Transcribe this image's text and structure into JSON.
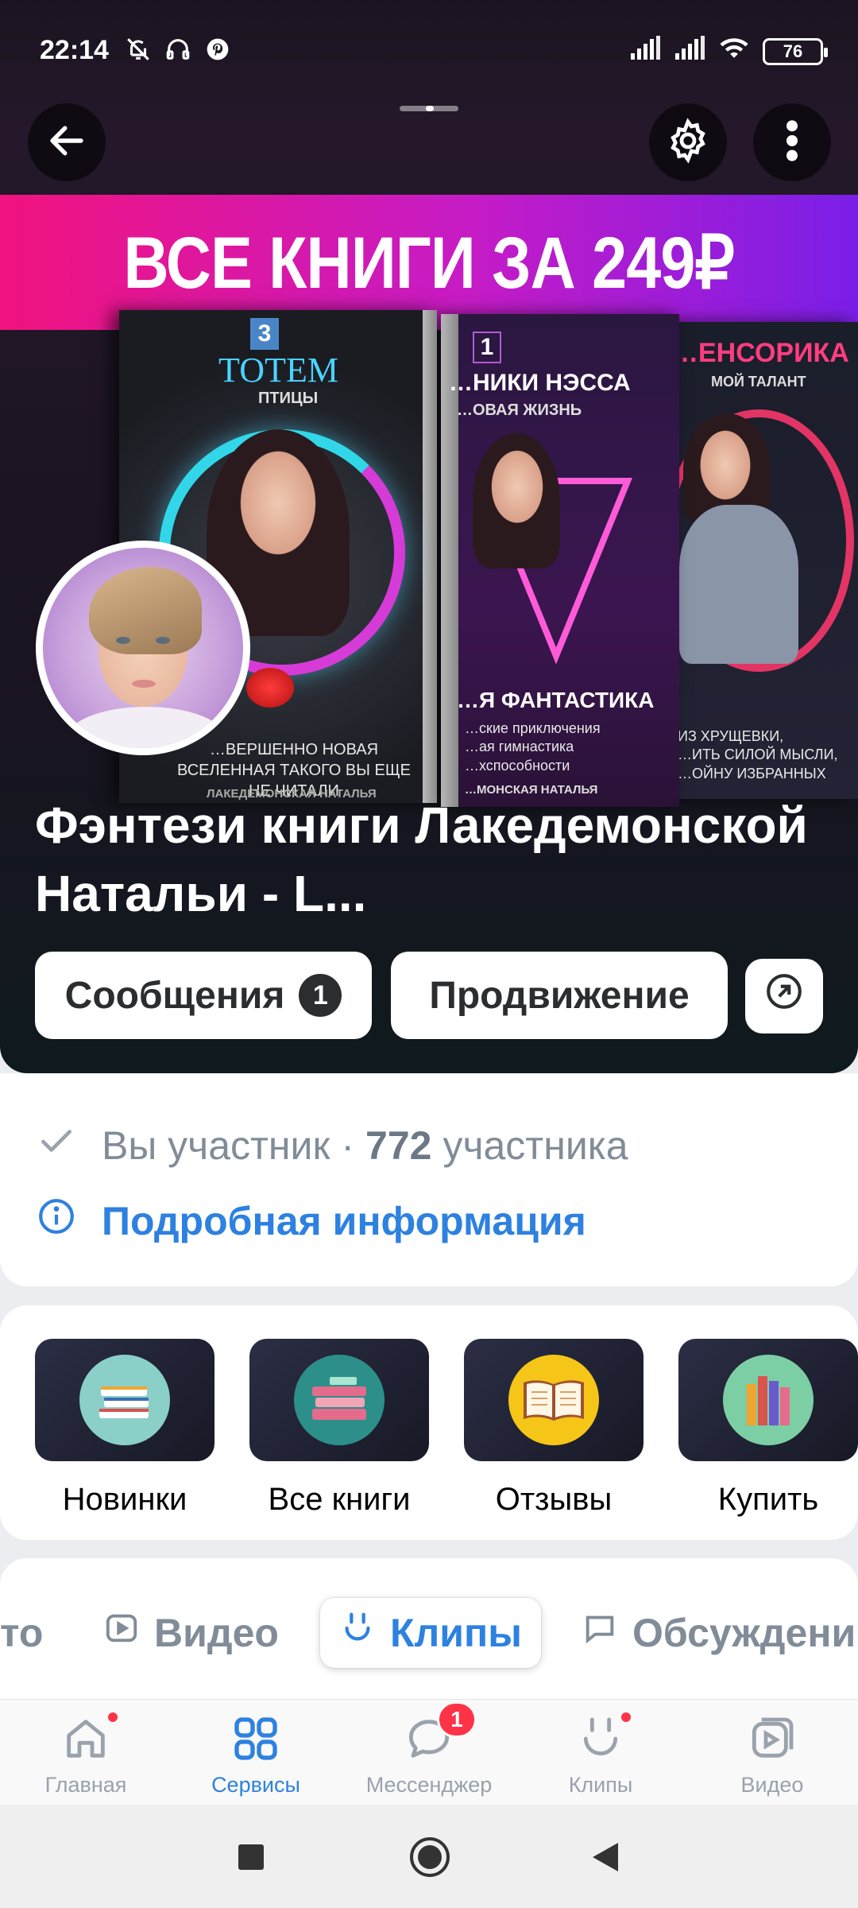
{
  "status_bar": {
    "time": "22:14",
    "battery": "76",
    "icons_left": [
      "mute-icon",
      "headphones-icon",
      "pinterest-icon"
    ],
    "icons_right": [
      "signal-icon",
      "signal-icon",
      "wifi-icon",
      "battery-icon"
    ]
  },
  "header": {
    "back_icon": "arrow-left-icon",
    "settings_icon": "gear-icon",
    "more_icon": "more-vertical-icon"
  },
  "cover": {
    "banner_text": "ВСЕ КНИГИ ЗА 249₽",
    "books": [
      {
        "number": "3",
        "title": "ТОТЕМ",
        "subtitle": "ПТИЦЫ",
        "bottom_text": "…ВЕРШЕННО НОВАЯ ВСЕЛЕННАЯ ТАКОГО ВЫ ЕЩЕ НЕ ЧИТАЛИ",
        "author": "ЛАКЕДЕМОНСКАЯ НАТАЛЬЯ"
      },
      {
        "number": "1",
        "title": "…НИКИ НЭССА",
        "subtitle": "…ОВАЯ ЖИЗНЬ",
        "bottom_text": "…Я ФАНТАСТИКА",
        "lines": [
          "…ские приключения",
          "…ая гимнастика",
          "…хспособности"
        ],
        "author": "…МОНСКАЯ НАТАЛЬЯ"
      },
      {
        "title": "…ЕНСОРИКА",
        "subtitle": "МОЙ ТАЛАНТ",
        "lines": [
          "ИЗ ХРУЩЕВКИ,",
          "…ИТЬ СИЛОЙ МЫСЛИ,",
          "…ОЙНУ ИЗБРАННЫХ"
        ]
      }
    ]
  },
  "group": {
    "title": "Фэнтези книги Лакедемонской Натальи - L...",
    "messages_label": "Сообщения",
    "messages_count": "1",
    "promotion_label": "Продвижение",
    "share_icon": "arrow-up-right-circle-icon"
  },
  "info": {
    "member_status": "Вы участник",
    "separator": "·",
    "member_count": "772",
    "member_word": "участника",
    "details_link": "Подробная информация"
  },
  "services": [
    {
      "label": "Новинки",
      "icon": "stack-of-books-icon",
      "circle_color": "#8ad0c9"
    },
    {
      "label": "Все книги",
      "icon": "books-pile-icon",
      "circle_color": "#2d8f8a"
    },
    {
      "label": "Отзывы",
      "icon": "open-book-icon",
      "circle_color": "#f5c518"
    },
    {
      "label": "Купить",
      "icon": "books-on-shelf-icon",
      "circle_color": "#7ccfa4"
    }
  ],
  "tabs": [
    {
      "label": "то",
      "icon": ""
    },
    {
      "label": "Видео",
      "icon": "video-icon"
    },
    {
      "label": "Клипы",
      "icon": "clips-icon",
      "active": true
    },
    {
      "label": "Обсуждени",
      "icon": "chat-icon"
    }
  ],
  "bottom_nav": [
    {
      "label": "Главная",
      "icon": "home-icon",
      "dot": true
    },
    {
      "label": "Сервисы",
      "icon": "services-icon",
      "active": true
    },
    {
      "label": "Мессенджер",
      "icon": "messenger-icon",
      "badge": "1"
    },
    {
      "label": "Клипы",
      "icon": "clips-icon",
      "dot": true
    },
    {
      "label": "Видео",
      "icon": "video-icon"
    }
  ],
  "system_nav": [
    "recents-icon",
    "home-circle-icon",
    "back-triangle-icon"
  ],
  "colors": {
    "accent": "#2d81e0",
    "badge_red": "#ff3347",
    "banner_pink": "#f1137f",
    "banner_purple": "#7a1ee8"
  }
}
